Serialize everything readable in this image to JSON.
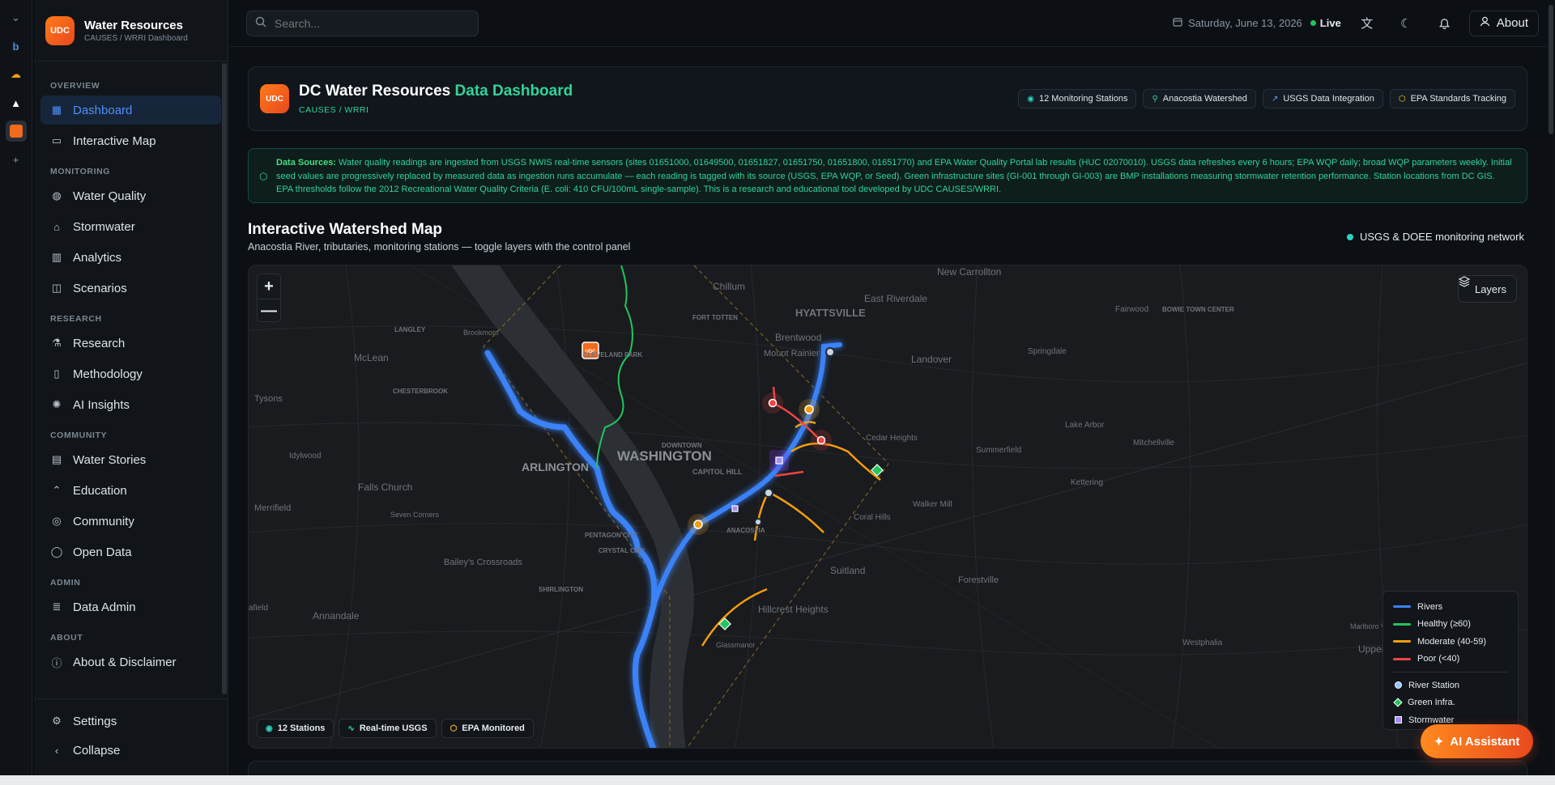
{
  "app": {
    "name": "Water Resources",
    "subtitle": "CAUSES / WRRI Dashboard",
    "logo_text": "UDC",
    "accent": "#4f8ff5",
    "brand_color": "#f26a1b"
  },
  "strip": {
    "icons": [
      "chevron-down-icon",
      "browser-icon",
      "cloud-icon",
      "triangle-icon",
      "udc-app-icon",
      "plus-icon"
    ]
  },
  "sidebar": {
    "sections": [
      {
        "label": "OVERVIEW",
        "items": [
          {
            "label": "Dashboard",
            "icon": "grid-icon",
            "active": true
          },
          {
            "label": "Interactive Map",
            "icon": "map-icon"
          }
        ]
      },
      {
        "label": "MONITORING",
        "items": [
          {
            "label": "Water Quality",
            "icon": "droplet-icon"
          },
          {
            "label": "Stormwater",
            "icon": "rain-icon"
          },
          {
            "label": "Analytics",
            "icon": "bar-chart-icon"
          },
          {
            "label": "Scenarios",
            "icon": "layers-icon"
          }
        ]
      },
      {
        "label": "RESEARCH",
        "items": [
          {
            "label": "Research",
            "icon": "flask-icon"
          },
          {
            "label": "Methodology",
            "icon": "book-icon"
          },
          {
            "label": "AI Insights",
            "icon": "brain-icon"
          }
        ]
      },
      {
        "label": "COMMUNITY",
        "items": [
          {
            "label": "Water Stories",
            "icon": "book-open-icon"
          },
          {
            "label": "Education",
            "icon": "graduation-cap-icon"
          },
          {
            "label": "Community",
            "icon": "users-icon"
          },
          {
            "label": "Open Data",
            "icon": "globe-icon"
          }
        ]
      },
      {
        "label": "ADMIN",
        "items": [
          {
            "label": "Data Admin",
            "icon": "database-icon"
          }
        ]
      },
      {
        "label": "ABOUT",
        "items": [
          {
            "label": "About & Disclaimer",
            "icon": "info-icon"
          }
        ]
      }
    ],
    "footer": {
      "settings": "Settings",
      "collapse": "Collapse"
    }
  },
  "topbar": {
    "search_placeholder": "Search...",
    "date": "Saturday, June 13, 2026",
    "live": "Live",
    "about": "About"
  },
  "header": {
    "logo_text": "UDC",
    "title_main": "DC Water Resources",
    "title_accent": "Data Dashboard",
    "subtitle": "CAUSES / WRRI",
    "badges": [
      {
        "label": "12 Monitoring Stations",
        "icon": "radio-icon",
        "color": "#2dd4bf"
      },
      {
        "label": "Anacostia Watershed",
        "icon": "map-pin-icon",
        "color": "#34d399"
      },
      {
        "label": "USGS Data Integration",
        "icon": "trending-up-icon",
        "color": "#60a5fa"
      },
      {
        "label": "EPA Standards Tracking",
        "icon": "shield-icon",
        "color": "#fbbf24"
      }
    ]
  },
  "sources": {
    "label": "Data Sources:",
    "text": "Water quality readings are ingested from USGS NWIS real-time sensors (sites 01651000, 01649500, 01651827, 01651750, 01651800, 01651770) and EPA Water Quality Portal lab results (HUC 02070010). USGS data refreshes every 6 hours; EPA WQP daily; broad WQP parameters weekly. Initial seed values are progressively replaced by measured data as ingestion runs accumulate — each reading is tagged with its source (USGS, EPA WQP, or Seed). Green infrastructure sites (GI-001 through GI-003) are BMP installations measuring stormwater retention performance. Station locations from DC GIS. EPA thresholds follow the 2012 Recreational Water Quality Criteria (E. coli: 410 CFU/100mL single-sample). This is a research and educational tool developed by UDC CAUSES/WRRI."
  },
  "map_section": {
    "title": "Interactive Watershed Map",
    "subtitle": "Anacostia River, tributaries, monitoring stations — toggle layers with the control panel",
    "network": "USGS & DOEE monitoring network",
    "zoom_in": "+",
    "zoom_out": "—",
    "layers": "Layers",
    "place_labels": [
      "New Carrollton",
      "Chillum",
      "East Riverdale",
      "HYATTSVILLE",
      "Fairwood",
      "BOWIE TOWN CENTER",
      "Brookmont",
      "LANGLEY",
      "Brentwood",
      "Mount Rainier",
      "Landover",
      "Springdale",
      "McLean",
      "FORT TOTTEN",
      "CLEVELAND PARK",
      "Tysons",
      "CHESTERBROOK",
      "Lake Arbor",
      "Cedar Heights",
      "Mitchellville",
      "Summerfield",
      "DOWNTOWN",
      "WASHINGTON",
      "ARLINGTON",
      "CAPITOL HILL",
      "Idylwood",
      "Kettering",
      "Falls Church",
      "Merrifield",
      "Seven Corners",
      "Coral Hills",
      "Walker Mill",
      "PENTAGON CITY",
      "CRYSTAL CITY",
      "ANACOSTIA",
      "Bailey's Crossroads",
      "Suitland",
      "Forestville",
      "SHIRLINGTON",
      "Annandale",
      "afield",
      "Hillcrest Heights",
      "Glassmanor",
      "Marlboro Village",
      "Westphalia",
      "Upper Ma"
    ],
    "legend": {
      "lines": [
        {
          "label": "Rivers",
          "color": "#3b82f6"
        },
        {
          "label": "Healthy (≥60)",
          "color": "#22c55e"
        },
        {
          "label": "Moderate (40-59)",
          "color": "#f59e0b"
        },
        {
          "label": "Poor (<40)",
          "color": "#ef4444"
        }
      ],
      "markers": [
        {
          "label": "River Station",
          "color": "#93c5fd",
          "shape": "circle"
        },
        {
          "label": "Green Infra.",
          "color": "#22c55e",
          "shape": "diamond"
        },
        {
          "label": "Stormwater",
          "color": "#a78bfa",
          "shape": "square"
        }
      ]
    },
    "chips": [
      {
        "label": "12 Stations",
        "icon": "radio-icon",
        "color": "#2dd4bf"
      },
      {
        "label": "Real-time USGS",
        "icon": "activity-icon",
        "color": "#2dd4bf"
      },
      {
        "label": "EPA Monitored",
        "icon": "shield-icon",
        "color": "#fbbf24"
      }
    ]
  },
  "ai_assistant": {
    "label": "AI Assistant"
  }
}
